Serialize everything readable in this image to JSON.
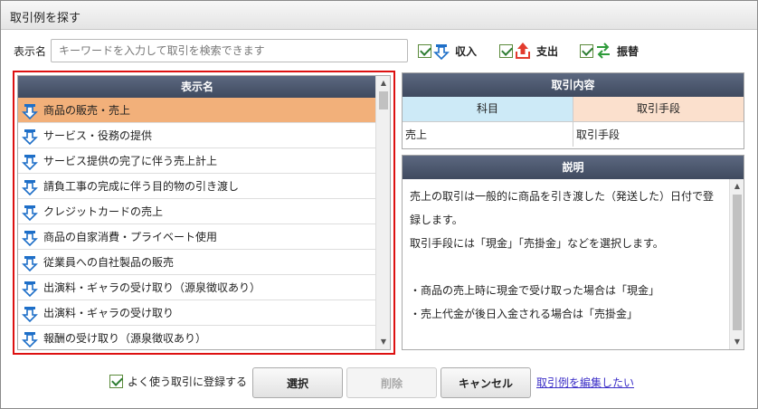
{
  "window": {
    "title": "取引例を探す"
  },
  "search": {
    "label": "表示名",
    "value": "",
    "placeholder": "キーワードを入力して取引を検索できます"
  },
  "filters": [
    {
      "label": "収入",
      "checked": true,
      "icon": "income-arrow-icon"
    },
    {
      "label": "支出",
      "checked": true,
      "icon": "expense-arrow-icon"
    },
    {
      "label": "振替",
      "checked": true,
      "icon": "transfer-arrows-icon"
    }
  ],
  "list": {
    "header": "表示名",
    "selected_index": 0,
    "items": [
      "商品の販売・売上",
      "サービス・役務の提供",
      "サービス提供の完了に伴う売上計上",
      "請負工事の完成に伴う目的物の引き渡し",
      "クレジットカードの売上",
      "商品の自家消費・プライベート使用",
      "従業員への自社製品の販売",
      "出演料・ギャラの受け取り（源泉徴収あり）",
      "出演料・ギャラの受け取り",
      "報酬の受け取り（源泉徴収あり）"
    ]
  },
  "details": {
    "header": "取引内容",
    "col1_header": "科目",
    "col2_header": "取引手段",
    "col1_value": "売上",
    "col2_value": "取引手段"
  },
  "description": {
    "header": "説明",
    "lines": [
      "売上の取引は一般的に商品を引き渡した（発送した）日付で登",
      "録します。",
      "取引手段には「現金」「売掛金」などを選択します。",
      "",
      "・商品の売上時に現金で受け取った場合は「現金」",
      "・売上代金が後日入金される場合は「売掛金」"
    ]
  },
  "footer": {
    "favorite_label": "よく使う取引に登録する",
    "favorite_checked": true,
    "select_label": "選択",
    "delete_label": "削除",
    "cancel_label": "キャンセル",
    "edit_link": "取引例を編集したい"
  },
  "colors": {
    "header_bg": "#4a5568",
    "selected_row": "#f2b07a",
    "income_icon": "#1e6fc8",
    "expense_icon": "#e23b2e",
    "transfer_icon": "#2e9b3a",
    "highlight_border": "#dd1111"
  }
}
